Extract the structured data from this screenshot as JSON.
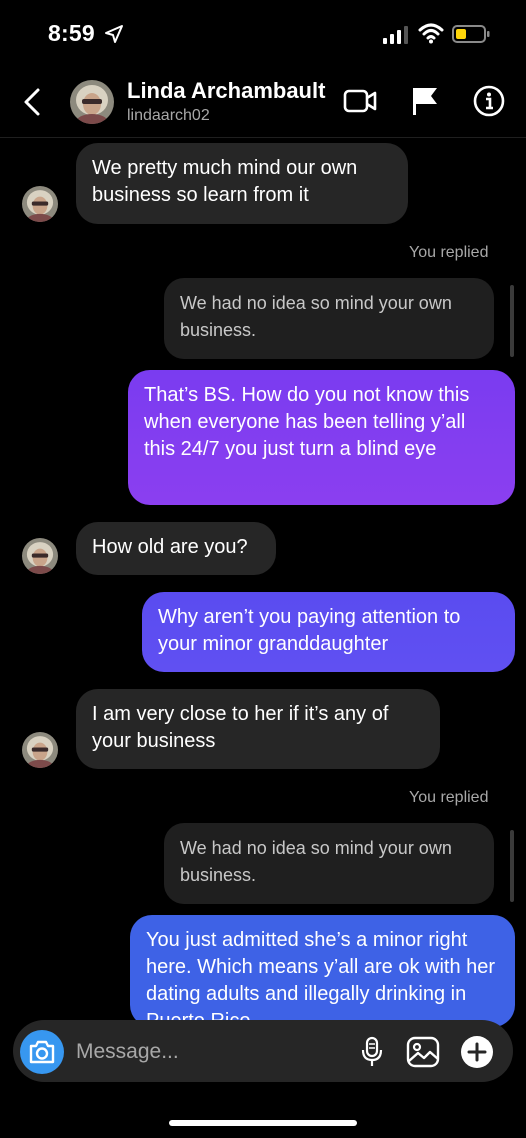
{
  "status_bar": {
    "time": "8:59"
  },
  "header": {
    "name": "Linda Archambault",
    "username": "lindaarch02"
  },
  "messages": {
    "m1": "We pretty much mind our own business so learn from it",
    "replied1": "You replied",
    "quote1": "We had no idea so mind your own business.",
    "m2": "That’s BS. How do you not know this when everyone has been telling y’all this 24/7 you just turn a blind eye",
    "m3": "How old are you?",
    "m4": "Why aren’t you paying attention to your minor granddaughter",
    "m5": "I am very close to her if it’s any of your business",
    "replied2": "You replied",
    "quote2": "We had no idea so mind your own business.",
    "m6": "You just admitted she’s a minor right here. Which means y’all are ok with her dating adults and illegally drinking in Puerto Rico"
  },
  "composer": {
    "placeholder": "Message..."
  },
  "icons": {
    "back": "chevron-left-icon",
    "video": "video-camera-icon",
    "flag": "flag-icon",
    "info": "info-icon",
    "camera": "camera-icon",
    "mic": "microphone-icon",
    "gallery": "gallery-icon",
    "add": "plus-icon"
  },
  "colors": {
    "background": "#000000",
    "incoming_bubble": "#262626",
    "outgoing_purple": "#8040f0",
    "outgoing_violet": "#5c4ef0",
    "outgoing_blue": "#3e62e6",
    "camera_button": "#3797f0"
  }
}
